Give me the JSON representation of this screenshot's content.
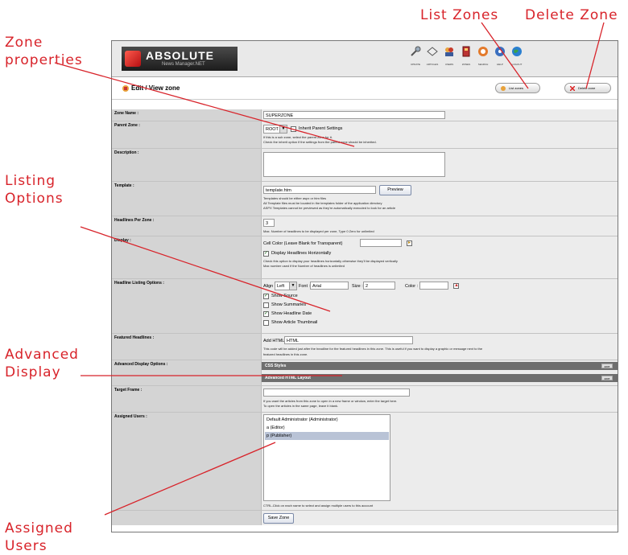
{
  "callouts": {
    "zone_properties": "Zone\nproperties",
    "listing_options": "Listing\nOptions",
    "advanced_display": "Advanced\nDisplay",
    "assigned_users": "Assigned\nUsers",
    "list_zones": "List Zones",
    "delete_zone": "Delete Zone"
  },
  "colors": {
    "callout": "#d8232a",
    "brand_red": "#c8141a",
    "bar": "#6e6e6e"
  },
  "header": {
    "logo_text": "ABSOLUTE",
    "logo_sub": "News Manager.NET",
    "nav": [
      {
        "label": "UPDATE",
        "icon": "wrench-icon"
      },
      {
        "label": "ARTICLES",
        "icon": "eye-icon"
      },
      {
        "label": "USERS",
        "icon": "users-icon"
      },
      {
        "label": "ZONES",
        "icon": "folder-icon"
      },
      {
        "label": "SEARCH",
        "icon": "search-icon"
      },
      {
        "label": "HELP",
        "icon": "help-icon"
      },
      {
        "label": "LOGOUT",
        "icon": "globe-icon"
      }
    ]
  },
  "page": {
    "title": "Edit / View zone",
    "list_button": "List zones",
    "delete_button": "Delete zone"
  },
  "form": {
    "zone_name": {
      "label": "Zone Name :",
      "value": "SUPERZONE"
    },
    "parent_zone": {
      "label": "Parent Zone :",
      "value": "ROOT",
      "inherit": "Inherit Parent Settings",
      "help1": "If this is a sub zone, select the parent zone for it.",
      "help2": "Check the inherit option if the settings from the parent zone should be inherited."
    },
    "description": {
      "label": "Description :",
      "value": ""
    },
    "template": {
      "label": "Template :",
      "value": "template.htm",
      "preview": "Preview",
      "help1": "Templates should be either aspx or htm files",
      "help2": "All Template files must be located in the templates folder of the application directory",
      "help3": "ASPX Templates cannot be previewed as they're automatically executed to look for an article"
    },
    "headlines": {
      "label": "Headlines Per Zone :",
      "value": "3",
      "help": "Max. Number of headlines to be displayed per zone, Type 0 Zero for unlimited"
    },
    "display": {
      "label": "Display :",
      "cell_color": "Cell Color (Leave Blank for Transparent)",
      "horiz": "Display Headlines Horizontally",
      "help1": "Check this option to display your headlines horizontally otherwise they'll be displayed vertically",
      "help2": "Max number used if the Number of headlines is unlimited"
    },
    "listing": {
      "label": "Headline Listing Options :",
      "align_label": "Align :",
      "align_value": "Left",
      "font_label": "Font :",
      "font_value": "Arial",
      "size_label": "Size :",
      "size_value": "2",
      "color_label": "Color :",
      "options": [
        {
          "text": "Show Source",
          "checked": true
        },
        {
          "text": "Show Summaries",
          "checked": false
        },
        {
          "text": "Show Headline Date",
          "checked": true
        },
        {
          "text": "Show Article Thumbnail",
          "checked": false
        }
      ]
    },
    "featured": {
      "label": "Featured Headlines :",
      "add_html": "Add HTML:",
      "value": "HTML",
      "help1": "This code will be added just after the headline for the featured headlines in this zone. This is useful if you want to display a graphic or message next to the",
      "help2": "featured headlines in this zone."
    },
    "advanced": {
      "label": "Advanced Display Options :",
      "bar1": "CSS Styles",
      "bar2": "Advanced HTML Layout",
      "edit": "EDIT"
    },
    "target": {
      "label": "Target Frame :",
      "value": "",
      "help1": "If you want the articles from this zone to open in a new frame or window, enter the target here.",
      "help2": "To open the articles in the same page, leave it blank."
    },
    "assigned": {
      "label": "Assigned Users :",
      "users": [
        "Default Administrator (Administrator)",
        "a (Editor)",
        "p (Publisher)"
      ],
      "help": "CTRL-Click on each name to select and assign multiple users to this account"
    },
    "save": "Save Zone"
  }
}
